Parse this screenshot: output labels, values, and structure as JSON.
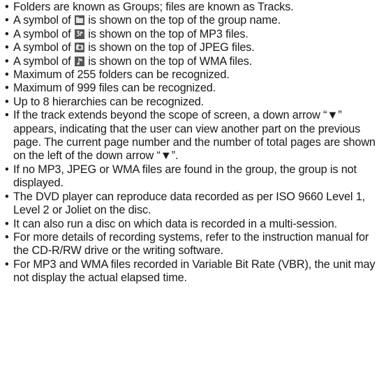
{
  "bullets": [
    {
      "text": "Folders are known as Groups; files are known as Tracks."
    },
    {
      "before": "A symbol of ",
      "icon": "folder-group-icon",
      "after": " is shown on the top of the group name."
    },
    {
      "before": "A symbol of ",
      "icon": "mp3-file-icon",
      "after": " is shown on the top of MP3 files."
    },
    {
      "before": "A symbol of ",
      "icon": "jpeg-file-icon",
      "after": " is shown on the top of JPEG files."
    },
    {
      "before": "A symbol of ",
      "icon": "wma-file-icon",
      "after": " is shown on the top of WMA files."
    },
    {
      "text": "Maximum of 255 folders can be recognized."
    },
    {
      "text": "Maximum of 999 files can be recognized."
    },
    {
      "text": "Up to 8 hierarchies can be recognized."
    },
    {
      "text": "If the track extends beyond the scope of screen, a down arrow “▼” appears, indicating that the user can view another part on the previous page. The current page number and the number of total pages are shown on the left of the down arrow “▼”."
    },
    {
      "text": "If no MP3, JPEG or WMA files are found in the group, the group is not displayed."
    },
    {
      "text": "The DVD player can reproduce data recorded as per ISO 9660 Level 1, Level 2 or Joliet on the disc."
    },
    {
      "text": "It can also run a disc on which data is recorded in a multi-session."
    },
    {
      "text": "For more details of recording systems, refer to the instruction manual for the CD-R/RW drive or the writing software."
    },
    {
      "text": "For MP3 and WMA files recorded in Variable Bit Rate (VBR), the unit may not display the actual elapsed time."
    }
  ]
}
